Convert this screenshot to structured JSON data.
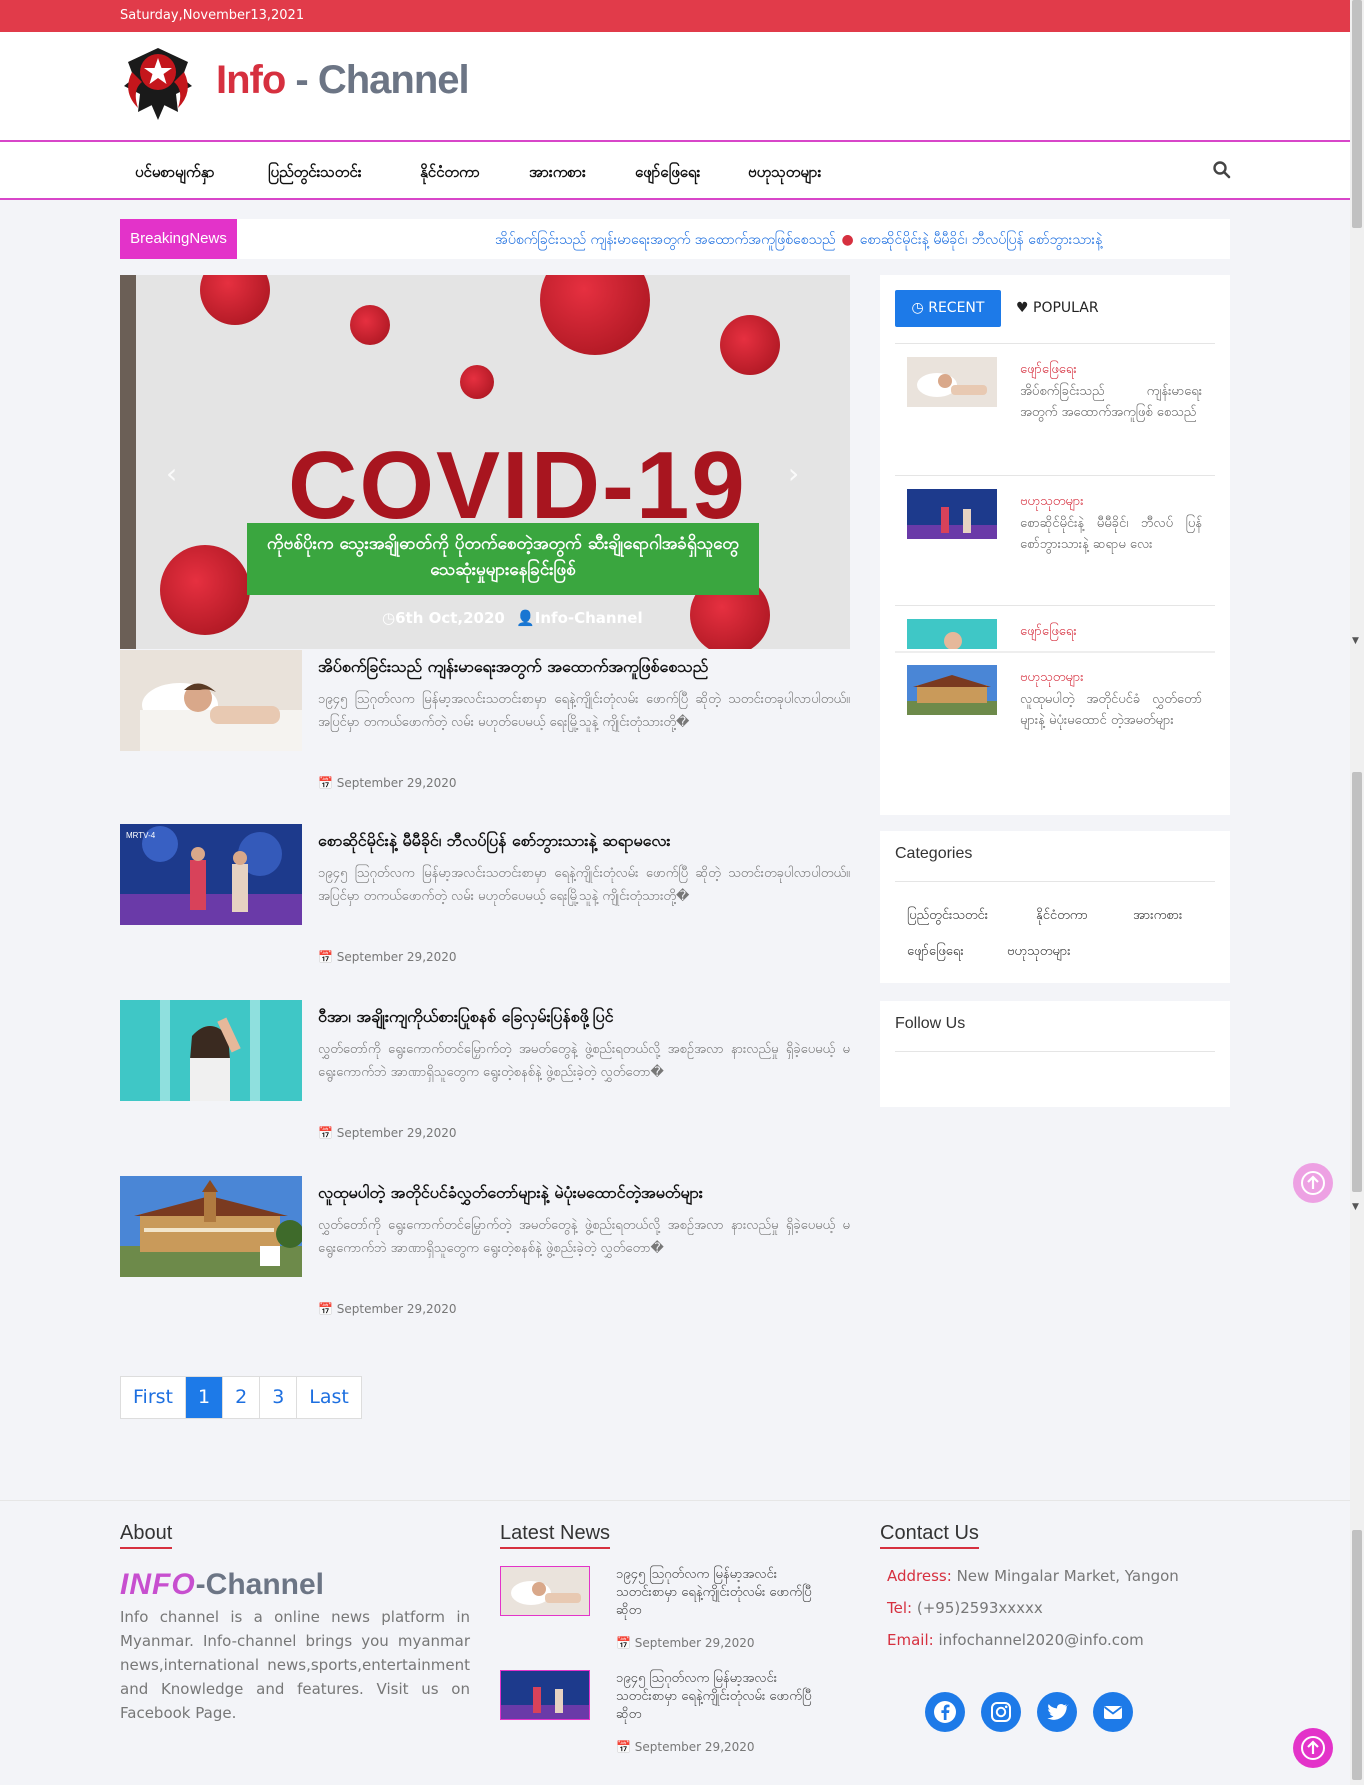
{
  "topbar": {
    "date": "Saturday,November13,2021"
  },
  "brand": {
    "name_a": "Info",
    "sep": " - ",
    "name_b": "Channel"
  },
  "nav": {
    "items": [
      "ပင်မစာမျက်နှာ",
      "ပြည်တွင်းသတင်း",
      "နိုင်ငံတကာ",
      "အားကစား",
      "ဖျော်ဖြေရေး",
      "ဗဟုသုတများ"
    ],
    "search_icon": "search-icon"
  },
  "breaking": {
    "label": "BreakingNews",
    "items": [
      "အိပ်စက်ခြင်းသည် ကျန်းမာရေးအတွက် အထောက်အကူဖြစ်စေသည်",
      "စောဆိုင်မိုင်းနဲ့ မီမီခိုင်၊ ဘီလပ်ပြန် စော်ဘွားသားနဲ့"
    ]
  },
  "hero": {
    "image_text": "COVID-19",
    "caption": "ကိုဗစ်ပိုးက သွေးအချိုဓာတ်ကို ပိုတက်စေတဲ့အတွက် ဆီးချိုရောဂါအခံရှိသူတွေ သေဆုံးမှုများနေခြင်းဖြစ်",
    "date": "6th Oct,2020",
    "author": "Info-Channel"
  },
  "posts": [
    {
      "title": "အိပ်စက်ခြင်းသည် ကျန်းမာရေးအတွက် အထောက်အကူဖြစ်စေသည်",
      "excerpt": "၁၉၄၅ ဩဂုတ်လက မြန်မာ့အလင်းသတင်းစာမှာ ရေနဲ့ကျိုင်းတုံလမ်း ဖောက်ပြီ ဆိုတဲ့ သတင်းတခုပါလာပါတယ်။ အပြင်မှာ တကယ်ဖောက်တဲ့ လမ်း မဟုတ်ပေမယ့် ရေးမြို့သူနဲ့ ကျိုင်းတုံသားတို့�",
      "date": "September 29,2020"
    },
    {
      "title": "စောဆိုင်မိုင်းနဲ့ မီမီခိုင်၊ ဘီလပ်ပြန် စော်ဘွားသားနဲ့ ဆရာမလေး",
      "excerpt": "၁၉၄၅ ဩဂုတ်လက မြန်မာ့အလင်းသတင်းစာမှာ ရေနဲ့ကျိုင်းတုံလမ်း ဖောက်ပြီ ဆိုတဲ့ သတင်းတခုပါလာပါတယ်။ အပြင်မှာ တကယ်ဖောက်တဲ့ လမ်း မဟုတ်ပေမယ့် ရေးမြို့သူနဲ့ ကျိုင်းတုံသားတို့�",
      "date": "September 29,2020"
    },
    {
      "title": "ဝီအာ၊ အချိုးကျကိုယ်စားပြုစနစ် ခြေလှမ်းပြန်စဖို့ပြင်",
      "excerpt": "လွှတ်တော်ကို ရွေးကောက်တင်မြှောက်တဲ့ အမတ်တွေနဲ့ ဖွဲ့စည်းရတယ်လို့ အစဉ်အလာ နားလည်မှု ရှိခဲ့ပေမယ့် မရွေးကောက်ဘဲ အာဏာရှိသူတွေက ရွေးတဲ့စနစ်နဲ့ ဖွဲ့စည်းခဲ့တဲ့ လွှတ်တော�",
      "date": "September 29,2020"
    },
    {
      "title": "လူထုမပါတဲ့ အတိုင်ပင်ခံလွှတ်တော်များနဲ့ မဲပုံးမထောင်တဲ့အမတ်များ",
      "excerpt": "လွှတ်တော်ကို ရွေးကောက်တင်မြှောက်တဲ့ အမတ်တွေနဲ့ ဖွဲ့စည်းရတယ်လို့ အစဉ်အလာ နားလည်မှု ရှိခဲ့ပေမယ့် မရွေးကောက်ဘဲ အာဏာရှိသူတွေက ရွေးတဲ့စနစ်နဲ့ ဖွဲ့စည်းခဲ့တဲ့ လွှတ်တော�",
      "date": "September 29,2020"
    }
  ],
  "pagination": [
    "First",
    "1",
    "2",
    "3",
    "Last"
  ],
  "sidebar": {
    "tab_recent": "RECENT",
    "tab_popular": "POPULAR",
    "recent": [
      {
        "cat": "ဖျော်ဖြေရေး",
        "title": "အိပ်စက်ခြင်းသည် ကျန်းမာရေး အတွက် အထောက်အကူဖြစ် စေသည်"
      },
      {
        "cat": "ဗဟုသုတများ",
        "title": "စောဆိုင်မိုင်းနဲ့ မီမီခိုင်၊ ဘီလပ် ပြန် စော်ဘွားသားနဲ့ ဆရာမ လေး"
      },
      {
        "cat": "ဖျော်ဖြေရေး",
        "title": ""
      },
      {
        "cat": "ဗဟုသုတများ",
        "title": "လူထုမပါတဲ့ အတိုင်ပင်ခံ လွှတ်တော်များနဲ့ မဲပုံးမထောင် တဲ့အမတ်များ"
      }
    ],
    "categories_title": "Categories",
    "categories": [
      "ပြည်တွင်းသတင်း",
      "နိုင်ငံတကာ",
      "အားကစား",
      "ဖျော်ဖြေရေး",
      "ဗဟုသုတများ"
    ],
    "follow_title": "Follow Us"
  },
  "footer": {
    "about_title": "About",
    "about_logo_a": "INFO",
    "about_logo_b": "-Channel",
    "about_text": "Info channel is a online news platform in Myanmar. Info-channel brings you myanmar news,international news,sports,entertainment and Knowledge and features. Visit us on Facebook Page.",
    "latest_title": "Latest News",
    "latest": [
      {
        "title": "၁၉၄၅ ဩဂုတ်လက မြန်မာ့အလင်း သတင်းစာမှာ ရေနဲ့ကျိုင်းတုံလမ်း ဖောက်ပြီ ဆိုတ",
        "date": "September 29,2020"
      },
      {
        "title": "၁၉၄၅ ဩဂုတ်လက မြန်မာ့အလင်း သတင်းစာမှာ ရေနဲ့ကျိုင်းတုံလမ်း ဖောက်ပြီ ဆိုတ",
        "date": "September 29,2020"
      }
    ],
    "contact_title": "Contact Us",
    "address_label": "Address:",
    "address": "New Mingalar Market, Yangon",
    "tel_label": "Tel:",
    "tel": "(+95)2593xxxxx",
    "email_label": "Email:",
    "email": "infochannel2020@info.com",
    "social": [
      "facebook-icon",
      "instagram-icon",
      "twitter-icon",
      "email-icon"
    ]
  },
  "colors": {
    "accent_red": "#e13b4a",
    "accent_pink": "#e333c9",
    "accent_blue": "#1d7ae8",
    "brand_gray": "#6c7585"
  }
}
